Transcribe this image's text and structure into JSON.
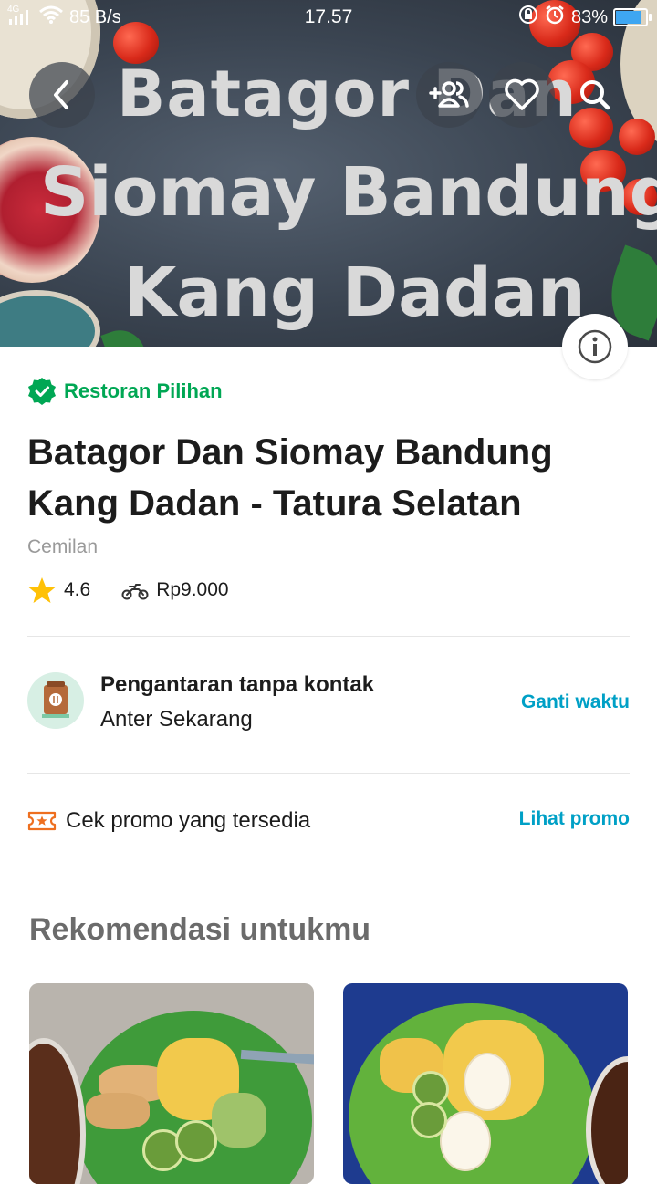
{
  "status_bar": {
    "network": "4G",
    "speed": "85 B/s",
    "time": "17.57",
    "battery": "83%",
    "battery_level": 0.83
  },
  "hero": {
    "line1": "Batagor Dan",
    "line2": "Siomay Bandung",
    "line3": "Kang Dadan"
  },
  "restaurant": {
    "badge": "Restoran Pilihan",
    "title_line1": "Batagor Dan Siomay Bandung",
    "title_line2": "Kang Dadan - Tatura Selatan",
    "category": "Cemilan",
    "rating": "4.6",
    "delivery_fee": "Rp9.000"
  },
  "delivery": {
    "title": "Pengantaran tanpa kontak",
    "subtitle": "Anter Sekarang",
    "action": "Ganti waktu"
  },
  "promo": {
    "text": "Cek promo yang tersedia",
    "action": "Lihat promo"
  },
  "recommendations": {
    "title": "Rekomendasi untukmu"
  },
  "colors": {
    "accent_green": "#00a754",
    "link_blue": "#00a0c6",
    "star": "#ffc107",
    "promo_orange": "#ee6f1f"
  }
}
